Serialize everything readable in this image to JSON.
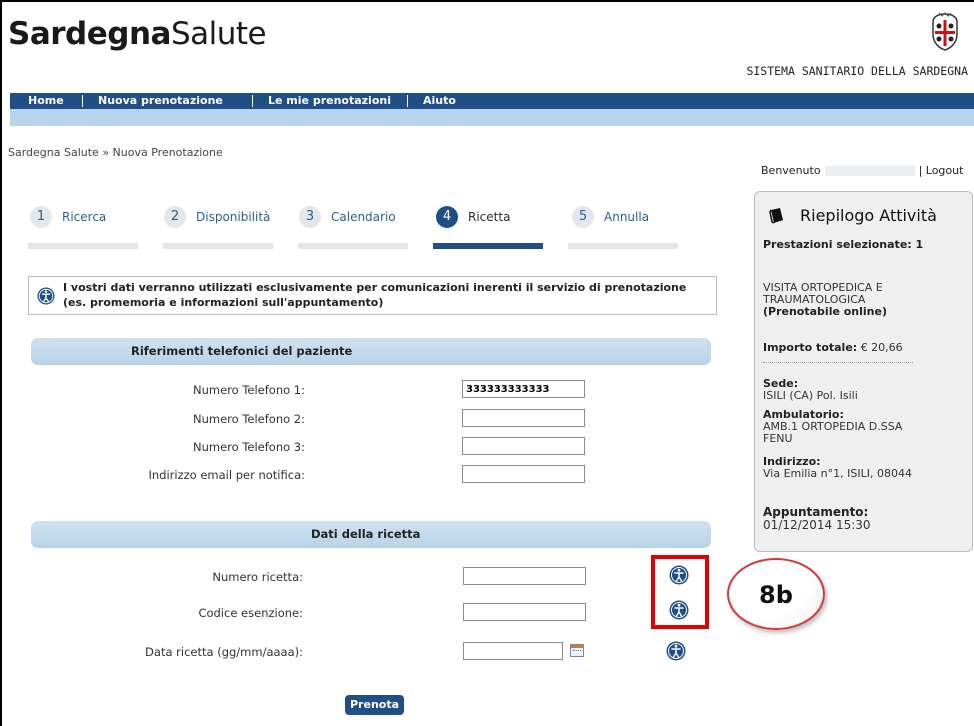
{
  "brand": {
    "bold": "Sardegna",
    "light": "Salute"
  },
  "header": {
    "system_name": "SISTEMA SANITARIO DELLA SARDEGNA"
  },
  "nav": {
    "items": [
      "Home",
      "Nuova prenotazione",
      "Le mie prenotazioni",
      "Aiuto"
    ]
  },
  "breadcrumb": "Sardegna Salute » Nuova Prenotazione",
  "user": {
    "welcome": "Benvenuto",
    "logout": "| Logout"
  },
  "steps": [
    {
      "num": "1",
      "label": "Ricerca"
    },
    {
      "num": "2",
      "label": "Disponibilità"
    },
    {
      "num": "3",
      "label": "Calendario"
    },
    {
      "num": "4",
      "label": "Ricetta",
      "active": true
    },
    {
      "num": "5",
      "label": "Annulla"
    }
  ],
  "notice": {
    "line1": "I vostri dati verranno utilizzati esclusivamente per comunicazioni inerenti il servizio di prenotazione",
    "line2": "(es. promemoria e informazioni sull'appuntamento)"
  },
  "phone_section": {
    "title": "Riferimenti telefonici del paziente",
    "fields": [
      {
        "label": "Numero Telefono 1:",
        "value": "333333333333"
      },
      {
        "label": "Numero Telefono 2:",
        "value": ""
      },
      {
        "label": "Numero Telefono 3:",
        "value": ""
      },
      {
        "label": "Indirizzo email per notifica:",
        "value": ""
      }
    ]
  },
  "recipe_section": {
    "title": "Dati della ricetta",
    "fields": [
      {
        "label": "Numero ricetta:",
        "value": ""
      },
      {
        "label": "Codice esenzione:",
        "value": ""
      },
      {
        "label": "Data ricetta (gg/mm/aaaa):",
        "value": ""
      }
    ]
  },
  "submit_label": "Prenota",
  "callout_label": "8b",
  "summary": {
    "title": "Riepilogo Attività",
    "selected": "Prestazioni selezionate: 1",
    "service_line1": "VISITA ORTOPEDICA E",
    "service_line2": "TRAUMATOLOGICA",
    "service_note": "(Prenotabile online)",
    "total_label": "Importo totale:",
    "total_value": "€ 20,66",
    "sede_label": "Sede:",
    "sede_value": "ISILI (CA) Pol. Isili",
    "ambulatorio_label": "Ambulatorio:",
    "ambulatorio_line1": "AMB.1 ORTOPEDIA D.SSA",
    "ambulatorio_line2": "FENU",
    "indirizzo_label": "Indirizzo:",
    "indirizzo_value": "Via Emilia n°1, ISILI, 08044",
    "appuntamento_label": "Appuntamento:",
    "appuntamento_value": "01/12/2014 15:30"
  },
  "colors": {
    "primary": "#1f4f86",
    "subbar": "#b6d5ed",
    "highlight": "#e00000"
  },
  "icons": [
    "crest-icon",
    "info-icon",
    "calendar-icon",
    "book-icon"
  ]
}
